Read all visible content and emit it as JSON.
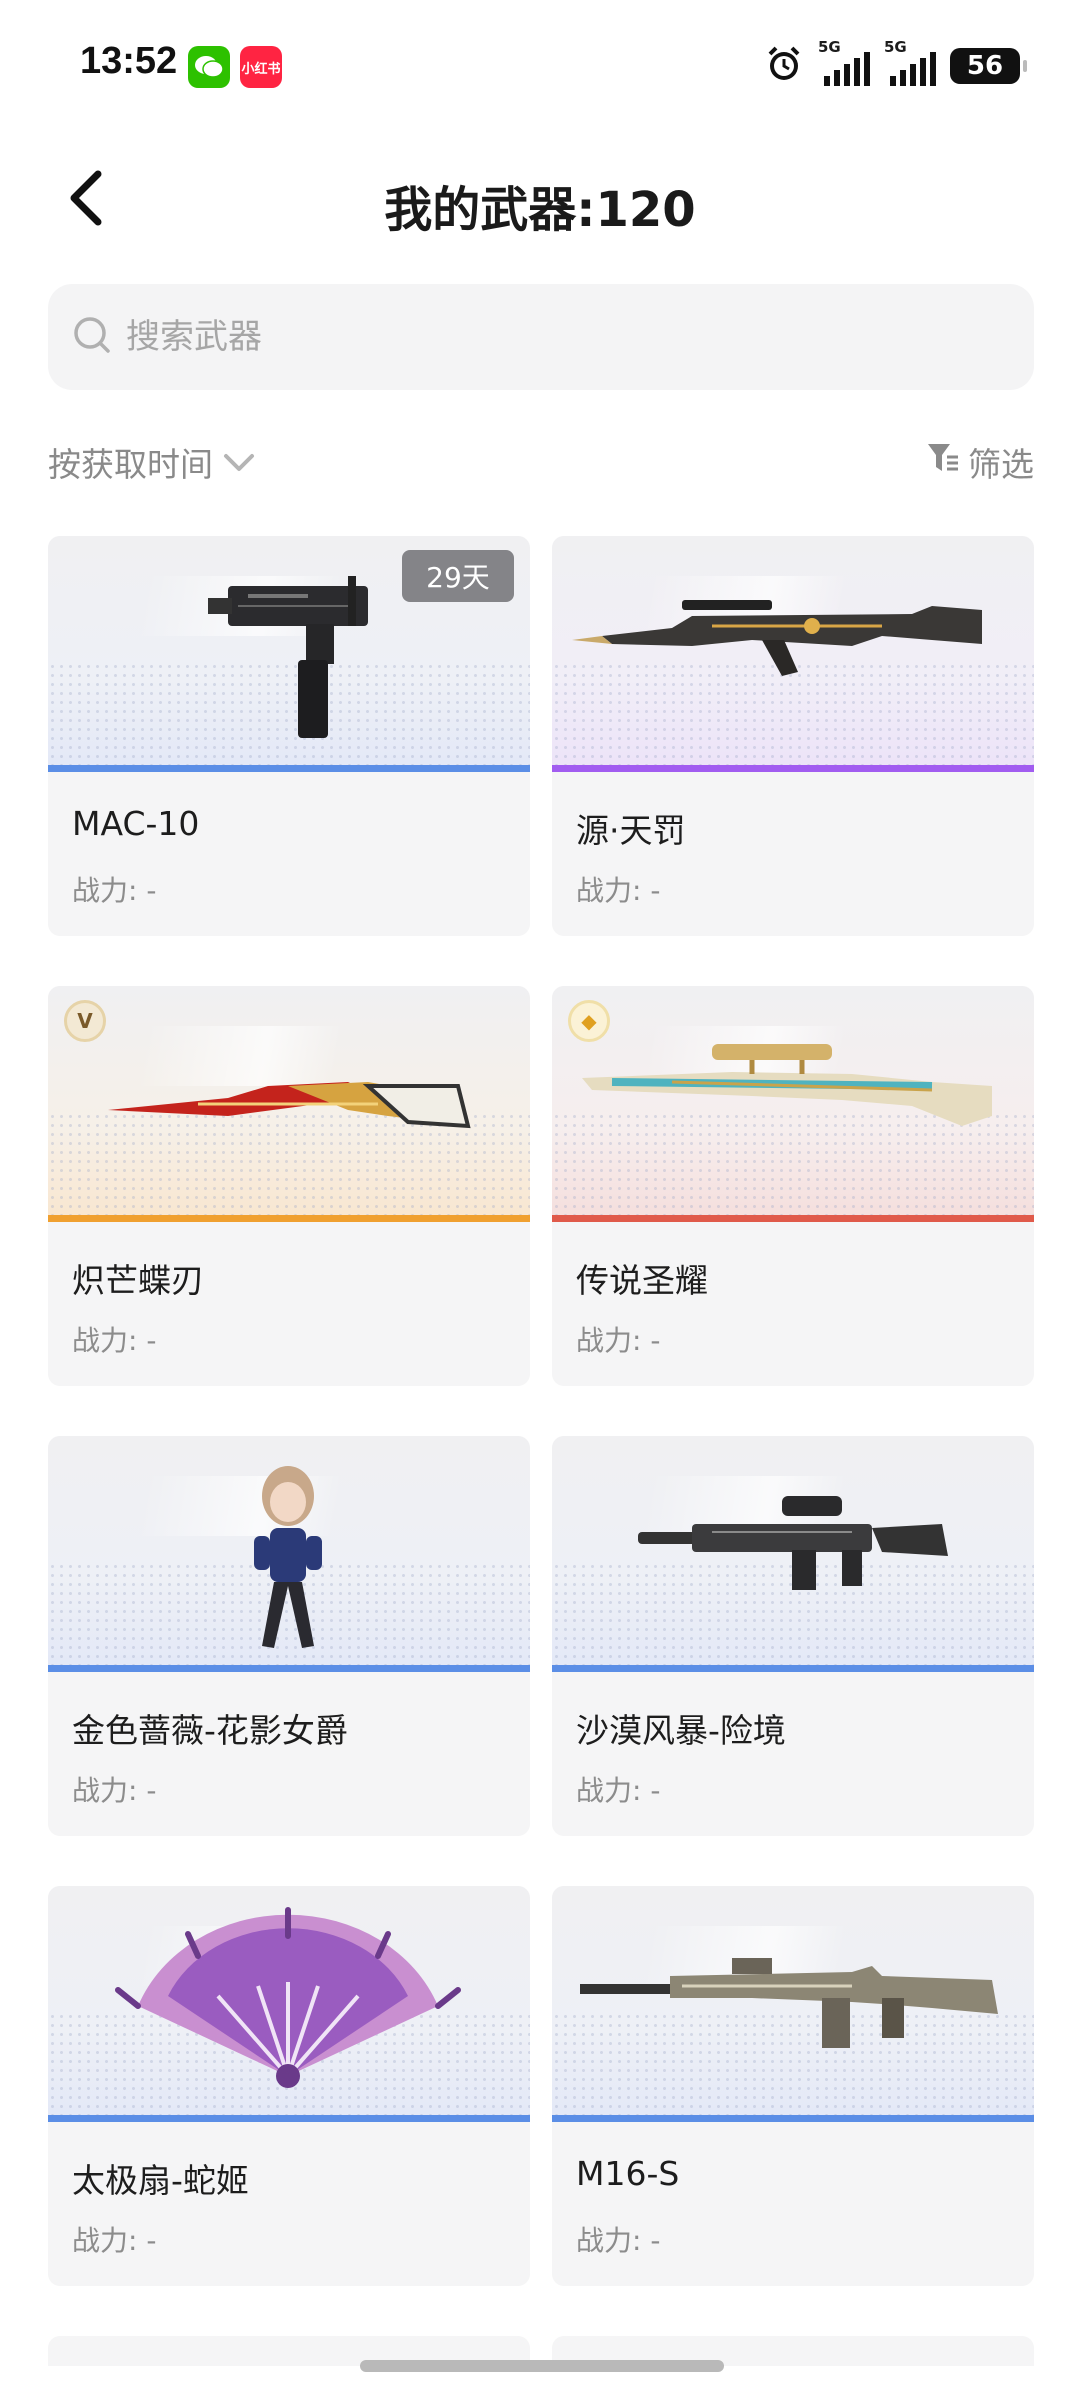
{
  "status_bar": {
    "time": "13:52",
    "apps": [
      {
        "name": "wechat-icon",
        "label": "",
        "color": "#2dc100"
      },
      {
        "name": "xiaohongshu-icon",
        "label": "小红书",
        "color": "#ff2442"
      }
    ],
    "signal_label_1": "5G",
    "signal_label_2": "5G",
    "battery": "56"
  },
  "header": {
    "back_icon": "chevron-left-icon",
    "title": "我的武器:120"
  },
  "search": {
    "placeholder": "搜索武器",
    "value": ""
  },
  "sort": {
    "label": "按获取时间",
    "icon": "chevron-down-icon"
  },
  "filter": {
    "label": "筛选",
    "icon": "filter-icon"
  },
  "weapons": [
    {
      "name": "MAC-10",
      "power": "战力: -",
      "days": "29天",
      "rarity_color": "#5b8ee6",
      "art": "smg-icon"
    },
    {
      "name": "源·天罚",
      "power": "战力: -",
      "rarity_color": "#a15cf0",
      "art": "rifle-icon"
    },
    {
      "name": "炽芒蝶刃",
      "power": "战力: -",
      "tier": "V",
      "rarity_color": "#f0a030",
      "art": "blade-icon"
    },
    {
      "name": "传说圣耀",
      "power": "战力: -",
      "tier": "◆",
      "rarity_color": "#e05a4a",
      "art": "sniper-icon"
    },
    {
      "name": "金色蔷薇-花影女爵",
      "power": "战力: -",
      "rarity_color": "#5b8ee6",
      "art": "character-icon"
    },
    {
      "name": "沙漠风暴-险境",
      "power": "战力: -",
      "rarity_color": "#5b8ee6",
      "art": "carbine-icon"
    },
    {
      "name": "太极扇-蛇姬",
      "power": "战力: -",
      "rarity_color": "#5b8ee6",
      "art": "fan-icon"
    },
    {
      "name": "M16-S",
      "power": "战力: -",
      "rarity_color": "#5b8ee6",
      "art": "assault-rifle-icon"
    }
  ]
}
